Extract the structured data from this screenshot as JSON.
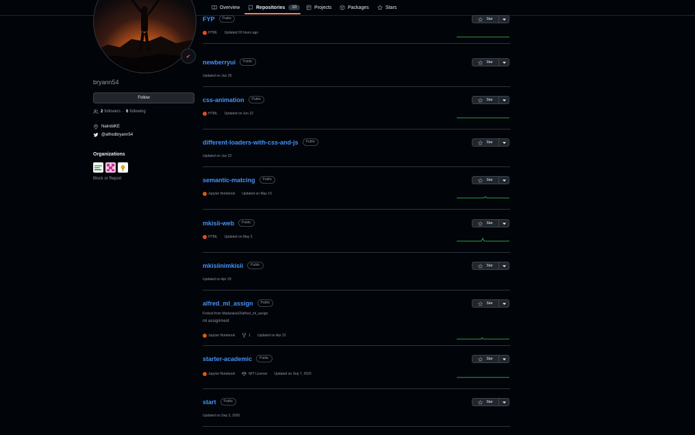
{
  "nav": {
    "tabs": [
      {
        "label": "Overview",
        "icon": "book-open-icon"
      },
      {
        "label": "Repositories",
        "icon": "repo-icon",
        "count": "10",
        "active": true
      },
      {
        "label": "Projects",
        "icon": "table-icon"
      },
      {
        "label": "Packages",
        "icon": "package-icon"
      },
      {
        "label": "Stars",
        "icon": "star-icon"
      }
    ]
  },
  "profile": {
    "username": "bryann54",
    "follow_label": "Follow",
    "followers_count": "2",
    "followers_label": "followers",
    "separator": "·",
    "following_count": "6",
    "following_label": "following",
    "location": "NairobiKE",
    "twitter": "@alfredbryann54",
    "organizations_title": "Organizations",
    "block_report": "Block or Report"
  },
  "colors": {
    "accent_link": "#4493f8",
    "tab_underline": "#f78166",
    "html_lang": "#e34c26",
    "jupyter_lang": "#DA5B0B",
    "sparkline": "#2ea043"
  },
  "repos": [
    {
      "name": "FYP",
      "visibility": "Public",
      "language": "HTML",
      "lang_color": "#e34c26",
      "updated": "Updated 20 hours ago",
      "star_label": "Star"
    },
    {
      "name": "newberryui",
      "visibility": "Public",
      "updated": "Updated on Jun 29",
      "star_label": "Star"
    },
    {
      "name": "css-animation",
      "visibility": "Public",
      "language": "HTML",
      "lang_color": "#e34c26",
      "updated": "Updated on Jun 22",
      "star_label": "Star"
    },
    {
      "name": "different-loaders-with-css-and-js",
      "visibility": "Public",
      "updated": "Updated on Jun 22",
      "star_label": "Star"
    },
    {
      "name": "semantic-matcing",
      "visibility": "Public",
      "language": "Jupyter Notebook",
      "lang_color": "#DA5B0B",
      "updated": "Updated on May 10",
      "star_label": "Star"
    },
    {
      "name": "mkisii-web",
      "visibility": "Public",
      "language": "HTML",
      "lang_color": "#e34c26",
      "updated": "Updated on May 2",
      "star_label": "Star"
    },
    {
      "name": "mkisiinimkisii",
      "visibility": "Public",
      "updated": "Updated on Apr 29",
      "star_label": "Star"
    },
    {
      "name": "alfred_ml_assign",
      "visibility": "Public",
      "forked_from": "Forked from Madaraka02/alfred_ml_assign",
      "description": "ml assignment",
      "language": "Jupyter Notebook",
      "lang_color": "#DA5B0B",
      "forks": "1",
      "updated": "Updated on Apr 22",
      "star_label": "Star"
    },
    {
      "name": "starter-academic",
      "visibility": "Public",
      "language": "Jupyter Notebook",
      "lang_color": "#DA5B0B",
      "license": "MIT License",
      "updated": "Updated on Sep 7, 2020",
      "star_label": "Star"
    },
    {
      "name": "start",
      "visibility": "Public",
      "updated": "Updated on Sep 3, 2020",
      "star_label": "Star"
    }
  ]
}
